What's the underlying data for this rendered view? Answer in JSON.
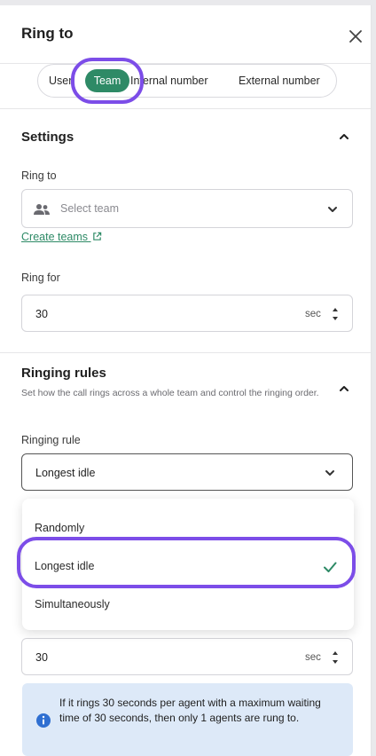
{
  "header": {
    "title": "Ring to"
  },
  "tabs": [
    {
      "label": "User"
    },
    {
      "label": "Team"
    },
    {
      "label": "Internal number"
    },
    {
      "label": "External number"
    }
  ],
  "settings": {
    "title": "Settings",
    "ring_to_label": "Ring to",
    "team_placeholder": "Select team",
    "create_teams_link": "Create teams",
    "ring_for_label": "Ring for",
    "ring_for_value": "30",
    "ring_for_unit": "sec"
  },
  "ringing_rules": {
    "title": "Ringing rules",
    "description": "Set how the call rings across a whole team and control the ringing order.",
    "rule_label": "Ringing rule",
    "rule_value": "Longest idle",
    "options": [
      {
        "label": "Randomly"
      },
      {
        "label": "Longest idle",
        "selected": true
      },
      {
        "label": "Simultaneously"
      }
    ],
    "per_agent_value": "30",
    "per_agent_unit": "sec",
    "info_text": "If it rings 30 seconds per agent with a maximum waiting time of 30 seconds, then only 1 agents are rung to."
  },
  "colors": {
    "accent": "#2e8a66",
    "highlight": "#7c4de8",
    "info_bg": "#dde9f8",
    "info_icon": "#2f6fd1"
  },
  "icons": [
    "close-icon",
    "chevron-up-icon",
    "team-icon",
    "chevron-down-icon",
    "external-link-icon",
    "spinner-arrows-icon",
    "check-icon",
    "info-icon"
  ]
}
